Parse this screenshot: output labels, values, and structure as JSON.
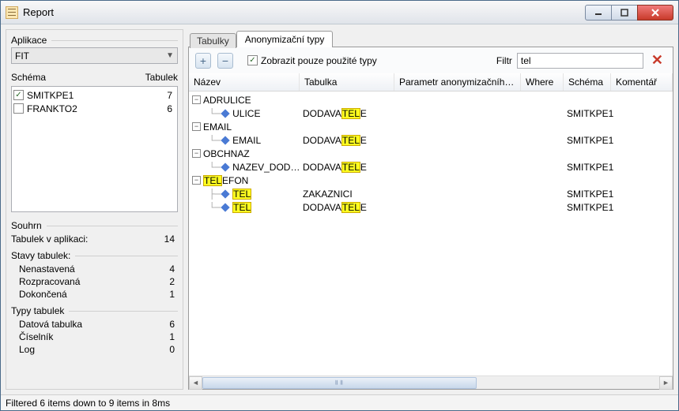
{
  "window": {
    "title": "Report"
  },
  "left": {
    "app_label": "Aplikace",
    "app_value": "FIT",
    "schema_label": "Schéma",
    "tabulek_label": "Tabulek",
    "schemas": [
      {
        "checked": true,
        "name": "SMITKPE1",
        "count": "7"
      },
      {
        "checked": false,
        "name": "FRANKTO2",
        "count": "6"
      }
    ],
    "summary_label": "Souhrn",
    "tables_in_app_label": "Tabulek v aplikaci:",
    "tables_in_app_value": "14",
    "states_label": "Stavy tabulek:",
    "states": [
      {
        "name": "Nenastavená",
        "count": "4"
      },
      {
        "name": "Rozpracovaná",
        "count": "2"
      },
      {
        "name": "Dokončená",
        "count": "1"
      }
    ],
    "types_label": "Typy tabulek",
    "types": [
      {
        "name": "Datová tabulka",
        "count": "6"
      },
      {
        "name": "Číselník",
        "count": "1"
      },
      {
        "name": "Log",
        "count": "0"
      }
    ]
  },
  "tabs": {
    "tabulky": "Tabulky",
    "anonym": "Anonymizační typy"
  },
  "toolbar": {
    "show_used_label": "Zobrazit pouze použité typy",
    "show_used_checked": true,
    "filter_label": "Filtr",
    "filter_value": "tel"
  },
  "columns": {
    "nazev": "Název",
    "tabulka": "Tabulka",
    "param": "Parametr anonymizačního typu",
    "where": "Where",
    "schema": "Schéma",
    "koment": "Komentář"
  },
  "tree": {
    "adrulice": {
      "label": "ADRULICE",
      "child": {
        "name": "ULICE",
        "tabulka_pre": "DODAVA",
        "tabulka_hl": "TEL",
        "tabulka_post": "E",
        "schema": "SMITKPE1"
      }
    },
    "email": {
      "label": "EMAIL",
      "child": {
        "name": "EMAIL",
        "tabulka_pre": "DODAVA",
        "tabulka_hl": "TEL",
        "tabulka_post": "E",
        "schema": "SMITKPE1"
      }
    },
    "obchnaz": {
      "label": "OBCHNAZ",
      "child": {
        "name": "NAZEV_DOD…",
        "tabulka_pre": "DODAVA",
        "tabulka_hl": "TEL",
        "tabulka_post": "E",
        "schema": "SMITKPE1"
      }
    },
    "telefon": {
      "label_hl": "TEL",
      "label_post": "EFON",
      "children": [
        {
          "name_hl": "TEL",
          "tabulka": "ZAKAZNICI",
          "schema": "SMITKPE1"
        },
        {
          "name_hl": "TEL",
          "tabulka_pre": "DODAVA",
          "tabulka_hl": "TEL",
          "tabulka_post": "E",
          "schema": "SMITKPE1"
        }
      ]
    }
  },
  "status": "Filtered 6 items down to 9 items in 8ms"
}
